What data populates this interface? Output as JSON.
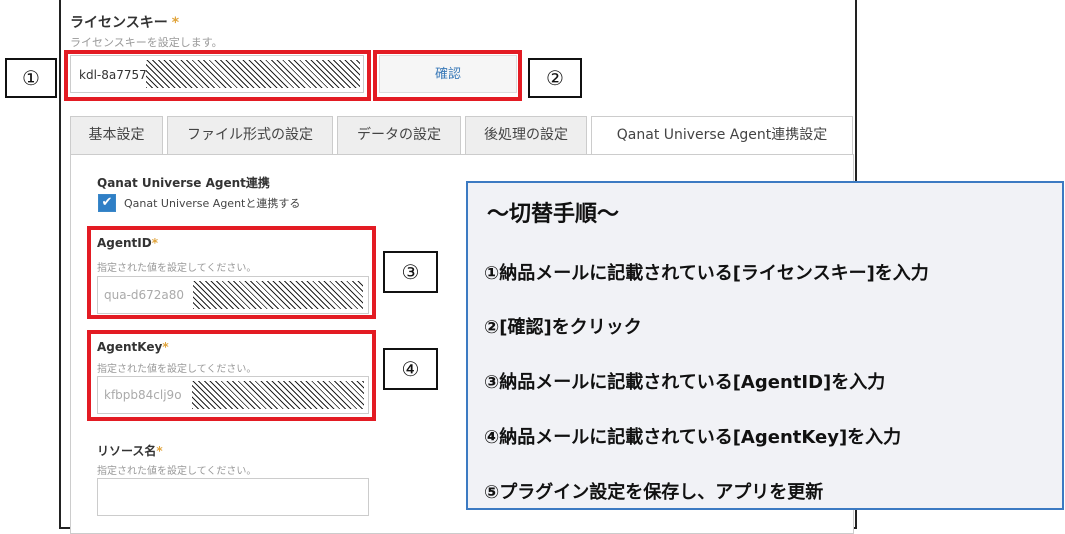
{
  "license": {
    "label": "ライセンスキー",
    "required_mark": "*",
    "description": "ライセンスキーを設定します。",
    "value": "kdl-8a7757",
    "confirm_label": "確認"
  },
  "tabs": [
    {
      "label": "基本設定"
    },
    {
      "label": "ファイル形式の設定"
    },
    {
      "label": "データの設定"
    },
    {
      "label": "後処理の設定"
    },
    {
      "label": "Qanat Universe Agent連携設定"
    }
  ],
  "agent_section": {
    "title": "Qanat Universe Agent連携",
    "checkbox_label": "Qanat Universe Agentと連携する",
    "checkbox_checked": true
  },
  "fields": {
    "agent_id": {
      "label": "AgentID",
      "required_mark": "*",
      "description": "指定された値を設定してください。",
      "value": "qua-d672a80"
    },
    "agent_key": {
      "label": "AgentKey",
      "required_mark": "*",
      "description": "指定された値を設定してください。",
      "value": "kfbpb84clj9o"
    },
    "resource": {
      "label": "リソース名",
      "required_mark": "*",
      "description": "指定された値を設定してください。",
      "value": ""
    }
  },
  "callouts": [
    "①",
    "②",
    "③",
    "④"
  ],
  "colors": {
    "highlight": "#e31b23",
    "link": "#3b7ab8",
    "note_border": "#3c7ac2",
    "checkbox": "#2f7fc6"
  },
  "instructions": {
    "title": "～切替手順～",
    "steps": [
      "①納品メールに記載されている[ライセンスキー]を入力",
      "②[確認]をクリック",
      "③納品メールに記載されている[AgentID]を入力",
      "④納品メールに記載されている[AgentKey]を入力",
      "⑤プラグイン設定を保存し、アプリを更新"
    ]
  }
}
